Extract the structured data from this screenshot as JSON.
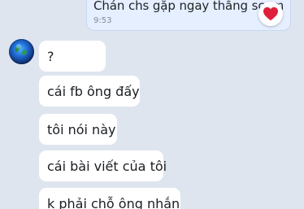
{
  "outgoing": {
    "text": "Chán chs gặp ngay thằng scam",
    "time": "9:53",
    "reaction": "heart-icon",
    "reaction_color": "#e0203a"
  },
  "incoming": {
    "avatar": "avatar-globe-icon",
    "messages": [
      "?",
      "cái fb ông đấy",
      "tôi nói này",
      "cái bài viết của tôi",
      "k phải chỗ ông nhắn"
    ]
  },
  "colors": {
    "background": "#dfe5ef",
    "outgoing_bubble": "#e5efff",
    "incoming_bubble": "#ffffff"
  }
}
